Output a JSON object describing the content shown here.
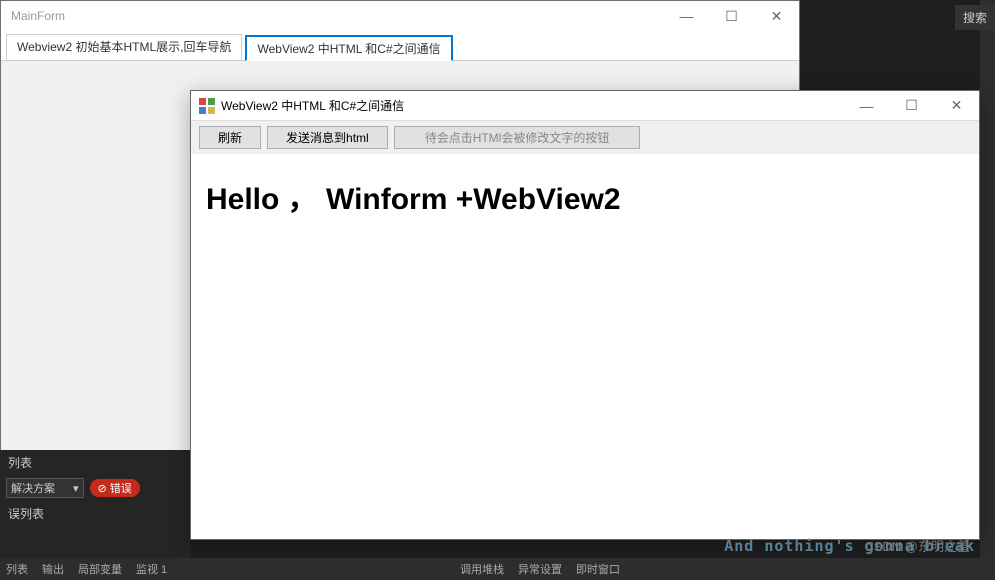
{
  "mainWindow": {
    "title": "MainForm",
    "controls": {
      "minimize": "—",
      "maximize": "☐",
      "close": "✕"
    },
    "tabs": [
      {
        "label": "Webview2 初始基本HTML展示,回车导航"
      },
      {
        "label": "WebView2 中HTML 和C#之间通信"
      }
    ]
  },
  "childWindow": {
    "title": "WebView2 中HTML 和C#之间通信",
    "controls": {
      "minimize": "—",
      "maximize": "☐",
      "close": "✕"
    },
    "toolbar": {
      "refresh": "刷新",
      "send": "发送消息到html",
      "pending": "待会点击HTMl会被修改文字的按钮"
    },
    "content": {
      "heading": "Hello ， Winform +WebView2"
    }
  },
  "ide": {
    "search": "搜索",
    "leftTab": "列表",
    "dropdown": "解决方案",
    "dropdownArrow": "▾",
    "errorBadge": "错误",
    "errorIcon": "⊘",
    "errorListLabel": "误列表",
    "bottomLeft": [
      "列表",
      "输出",
      "局部变量",
      "监视 1"
    ],
    "bottomMid": [
      "调用堆栈",
      "异常设置",
      "即时窗口"
    ]
  },
  "watermark": "And nothing's gonna break",
  "csdn": "CSDN @东明之羞"
}
